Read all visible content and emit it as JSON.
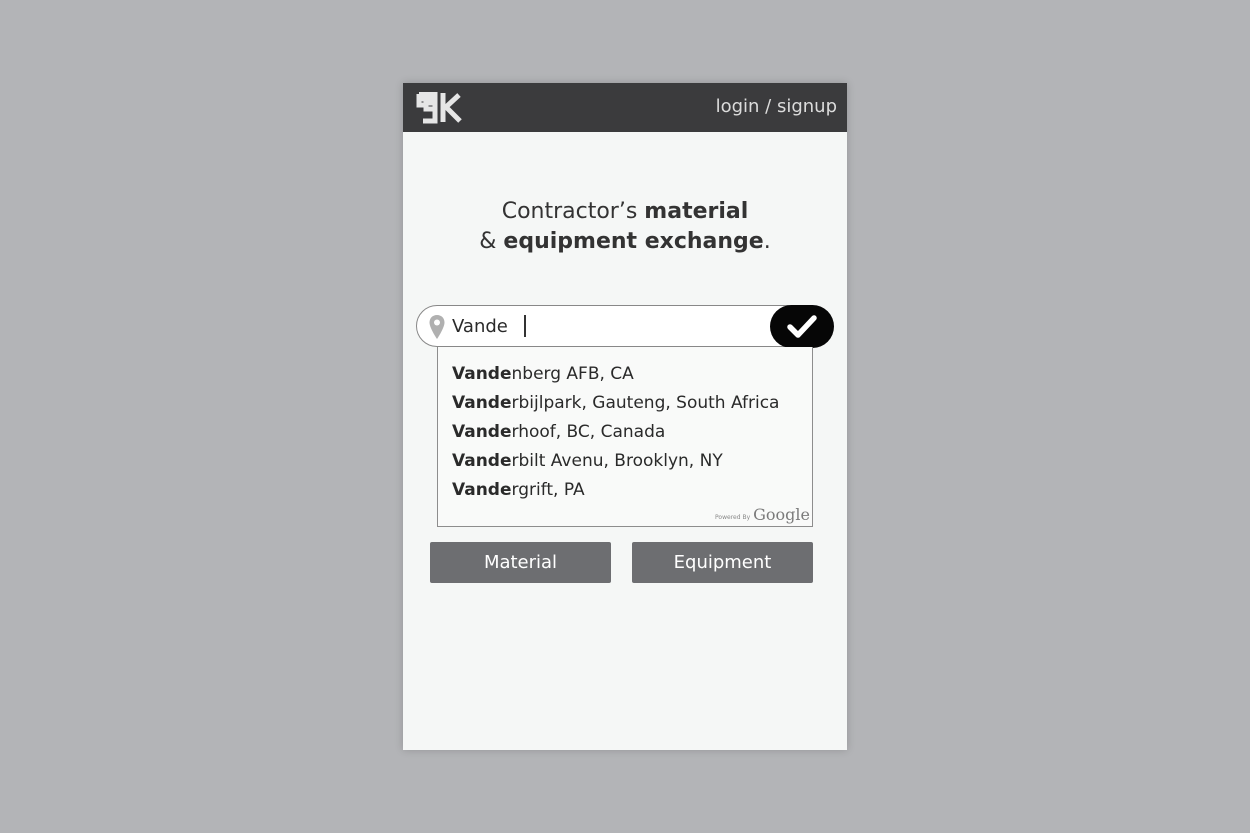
{
  "header": {
    "logo_text": "9K",
    "login_label": "login / signup"
  },
  "headline": {
    "line1_prefix": "Contractor’s ",
    "line1_bold": "material",
    "line2_prefix": "& ",
    "line2_bold": "equipment exchange",
    "line2_suffix": "."
  },
  "search": {
    "value": "Vande",
    "icon": "map-pin-icon",
    "submit_icon": "checkmark-icon"
  },
  "suggestions": {
    "items": [
      {
        "match": "Vande",
        "rest": "nberg AFB, CA"
      },
      {
        "match": "Vande",
        "rest": "rbijlpark, Gauteng, South Africa"
      },
      {
        "match": "Vande",
        "rest": "rhoof, BC, Canada"
      },
      {
        "match": "Vande",
        "rest": "rbilt Avenu, Brooklyn, NY"
      },
      {
        "match": "Vande",
        "rest": "rgrift, PA"
      }
    ],
    "powered_by": "Powered By",
    "google": "Google"
  },
  "categories": {
    "material_label": "Material",
    "equipment_label": "Equipment"
  },
  "colors": {
    "page_bg": "#b3b4b7",
    "topbar": "#3b3b3d",
    "button_gray": "#6d6e71",
    "go_button": "#060606"
  }
}
